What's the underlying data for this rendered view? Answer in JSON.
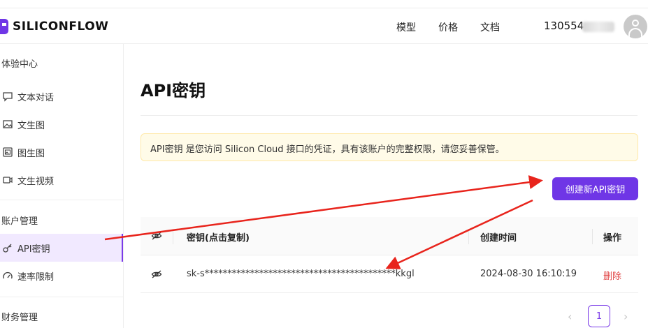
{
  "header": {
    "logo_text": "SILICONFLOW",
    "nav": [
      "模型",
      "价格",
      "文档"
    ],
    "user_id": "130554"
  },
  "sidebar": {
    "sections": [
      {
        "title": "体验中心",
        "items": [
          {
            "label": "文本对话",
            "icon": "chat-icon"
          },
          {
            "label": "文生图",
            "icon": "image-icon"
          },
          {
            "label": "图生图",
            "icon": "image-to-image-icon"
          },
          {
            "label": "文生视频",
            "icon": "video-icon"
          }
        ]
      },
      {
        "title": "账户管理",
        "items": [
          {
            "label": "API密钥",
            "icon": "key-icon",
            "active": true
          },
          {
            "label": "速率限制",
            "icon": "speed-icon"
          }
        ]
      },
      {
        "title": "财务管理",
        "items": []
      }
    ]
  },
  "main": {
    "title": "API密钥",
    "notice": "API密钥 是您访问 Silicon Cloud 接口的凭证，具有该账户的完整权限，请您妥善保管。",
    "create_button": "创建新API密钥",
    "table": {
      "headers": [
        "密钥(点击复制)",
        "创建时间",
        "操作"
      ],
      "rows": [
        {
          "key": "sk-s******************************************kkgl",
          "created": "2024-08-30 16:10:19",
          "action": "删除"
        }
      ]
    },
    "pagination": {
      "current": "1",
      "prev": "‹",
      "next": "›"
    }
  },
  "colors": {
    "brand": "#6f36e6",
    "danger": "#e24b4b",
    "annotation": "#e8241c"
  }
}
